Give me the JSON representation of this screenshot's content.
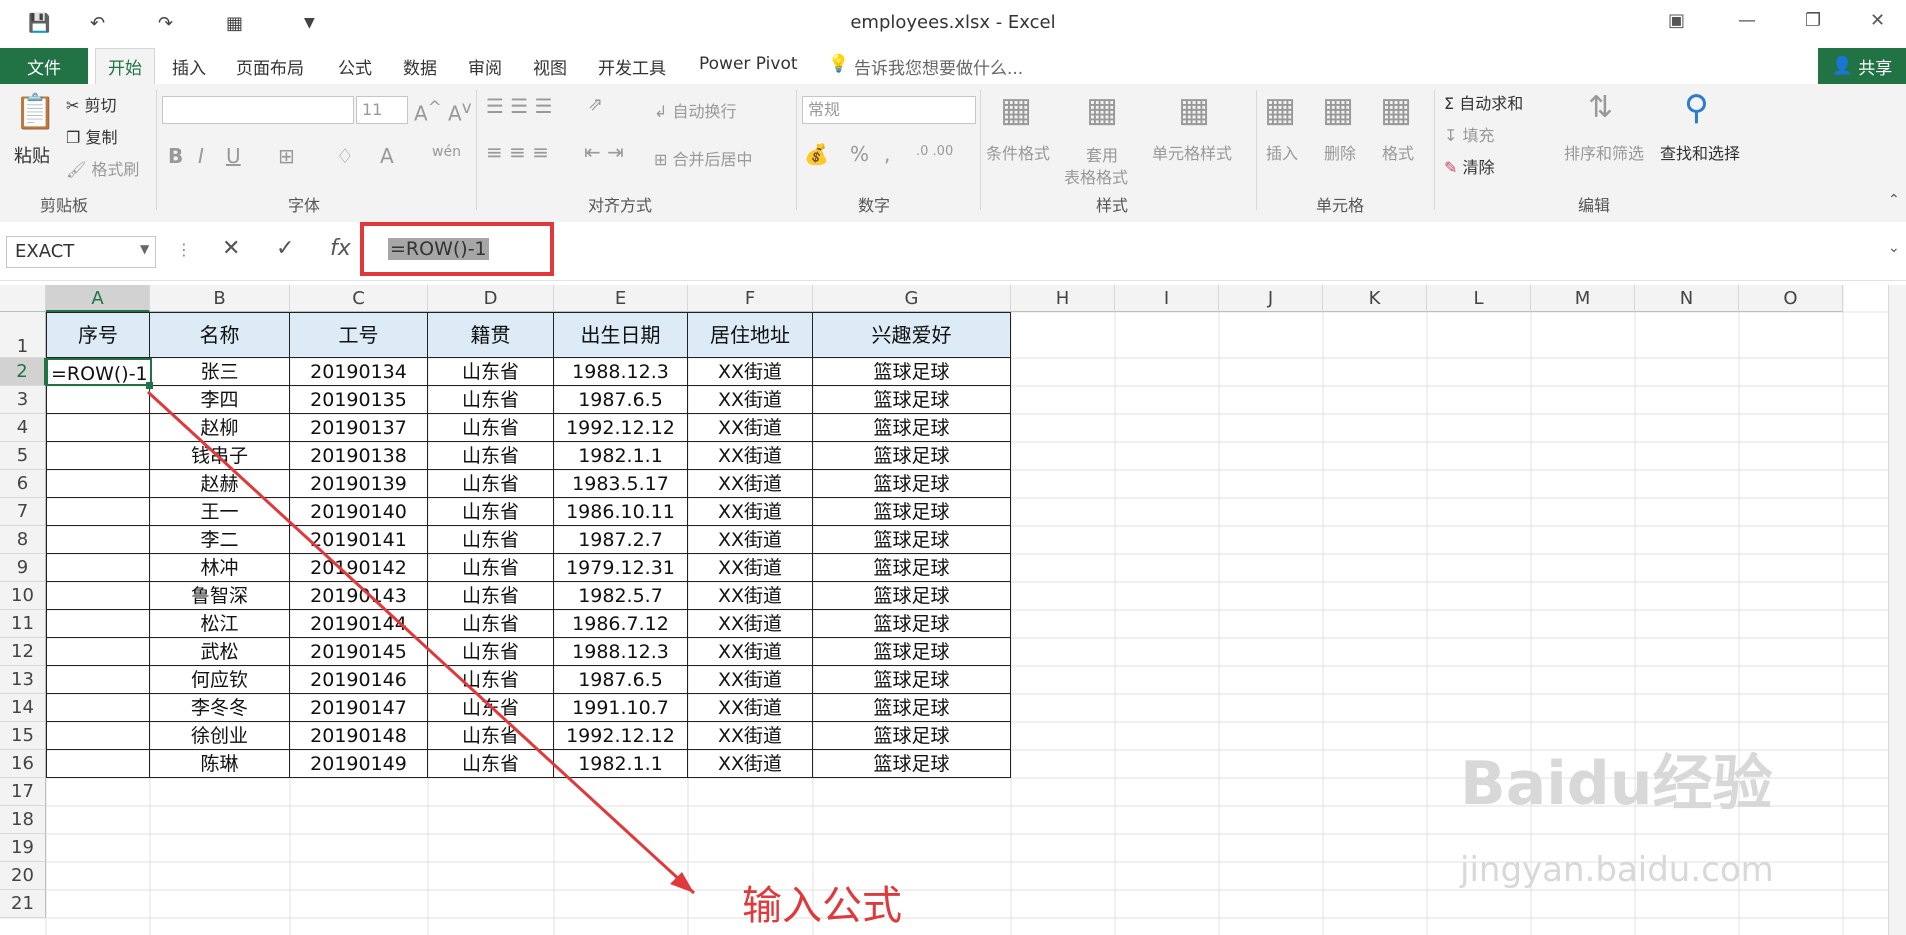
{
  "window": {
    "title": "employees.xlsx - Excel"
  },
  "tabs": [
    "开始",
    "插入",
    "页面布局",
    "公式",
    "数据",
    "审阅",
    "视图",
    "开发工具",
    "Power Pivot"
  ],
  "file_tab": "文件",
  "tell_me": "告诉我您想要做什么...",
  "share_label": "共享",
  "ribbon": {
    "paste": "粘贴",
    "cut": "剪切",
    "copy": "复制",
    "format_painter": "格式刷",
    "clipboard_group": "剪贴板",
    "font_size": "11",
    "font_group": "字体",
    "wrap_text": "自动换行",
    "merge_center": "合并后居中",
    "align_group": "对齐方式",
    "number_format": "常规",
    "number_group": "数字",
    "conditional_format": "条件格式",
    "table_format_1": "套用",
    "table_format_2": "表格格式",
    "cell_styles": "单元格样式",
    "styles_group": "样式",
    "insert": "插入",
    "delete": "删除",
    "format": "格式",
    "cells_group": "单元格",
    "autosum": "自动求和",
    "fill": "填充",
    "clear": "清除",
    "sort_filter": "排序和筛选",
    "find_select": "查找和选择",
    "edit_group": "编辑"
  },
  "formula_bar": {
    "name_box": "EXACT",
    "formula": "=ROW()-1"
  },
  "columns": [
    "A",
    "B",
    "C",
    "D",
    "E",
    "F",
    "G",
    "H",
    "I",
    "J",
    "K",
    "L",
    "M",
    "N",
    "O"
  ],
  "rows": [
    "1",
    "2",
    "3",
    "4",
    "5",
    "6",
    "7",
    "8",
    "9",
    "10",
    "11",
    "12",
    "13",
    "14",
    "15",
    "16",
    "17",
    "18",
    "19",
    "20",
    "21"
  ],
  "table": {
    "headers": [
      "序号",
      "名称",
      "工号",
      "籍贯",
      "出生日期",
      "居住地址",
      "兴趣爱好"
    ],
    "editing_cell": "=ROW()-1",
    "rows": [
      [
        "张三",
        "20190134",
        "山东省",
        "1988.12.3",
        "XX街道",
        "篮球足球"
      ],
      [
        "李四",
        "20190135",
        "山东省",
        "1987.6.5",
        "XX街道",
        "篮球足球"
      ],
      [
        "赵柳",
        "20190137",
        "山东省",
        "1992.12.12",
        "XX街道",
        "篮球足球"
      ],
      [
        "钱串子",
        "20190138",
        "山东省",
        "1982.1.1",
        "XX街道",
        "篮球足球"
      ],
      [
        "赵赫",
        "20190139",
        "山东省",
        "1983.5.17",
        "XX街道",
        "篮球足球"
      ],
      [
        "王一",
        "20190140",
        "山东省",
        "1986.10.11",
        "XX街道",
        "篮球足球"
      ],
      [
        "李二",
        "20190141",
        "山东省",
        "1987.2.7",
        "XX街道",
        "篮球足球"
      ],
      [
        "林冲",
        "20190142",
        "山东省",
        "1979.12.31",
        "XX街道",
        "篮球足球"
      ],
      [
        "鲁智深",
        "20190143",
        "山东省",
        "1982.5.7",
        "XX街道",
        "篮球足球"
      ],
      [
        "松江",
        "20190144",
        "山东省",
        "1986.7.12",
        "XX街道",
        "篮球足球"
      ],
      [
        "武松",
        "20190145",
        "山东省",
        "1988.12.3",
        "XX街道",
        "篮球足球"
      ],
      [
        "何应钦",
        "20190146",
        "山东省",
        "1987.6.5",
        "XX街道",
        "篮球足球"
      ],
      [
        "李冬冬",
        "20190147",
        "山东省",
        "1991.10.7",
        "XX街道",
        "篮球足球"
      ],
      [
        "徐创业",
        "20190148",
        "山东省",
        "1992.12.12",
        "XX街道",
        "篮球足球"
      ],
      [
        "陈琳",
        "20190149",
        "山东省",
        "1982.1.1",
        "XX街道",
        "篮球足球"
      ]
    ]
  },
  "annotation": "输入公式",
  "watermark": "Baidu经验",
  "watermark_url": "jingyan.baidu.com",
  "colors": {
    "excel_green": "#217346",
    "header_fill": "#ddebf7",
    "annotation_red": "#e0393b"
  }
}
